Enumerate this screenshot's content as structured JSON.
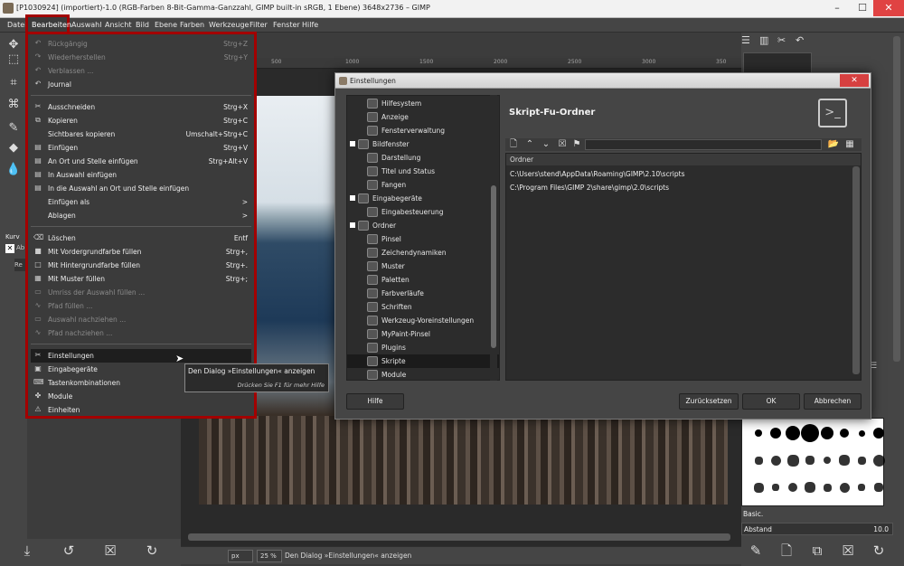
{
  "window": {
    "title": "[P1030924] (importiert)-1.0 (RGB-Farben 8-Bit-Gamma-Ganzzahl, GIMP built-in sRGB, 1 Ebene) 3648x2736 – GIMP",
    "minimize": "–",
    "maximize": "☐",
    "close": "✕"
  },
  "menubar": [
    "Datei",
    "Bearbeiten",
    "Auswahl",
    "Ansicht",
    "Bild",
    "Ebene",
    "Farben",
    "Werkzeuge",
    "Filter",
    "Fenster",
    "Hilfe"
  ],
  "edit_menu": {
    "items": [
      {
        "label": "Rückgängig",
        "shortcut": "Strg+Z",
        "disabled": true,
        "icon": "↶"
      },
      {
        "label": "Wiederherstellen",
        "shortcut": "Strg+Y",
        "disabled": true,
        "icon": "↷"
      },
      {
        "label": "Verblassen ...",
        "shortcut": "",
        "disabled": true,
        "icon": "↶"
      },
      {
        "label": "Journal",
        "shortcut": "",
        "disabled": false,
        "icon": "↶"
      },
      {
        "label": "Ausschneiden",
        "shortcut": "Strg+X",
        "disabled": false,
        "icon": "✂"
      },
      {
        "label": "Kopieren",
        "shortcut": "Strg+C",
        "disabled": false,
        "icon": "⧉"
      },
      {
        "label": "Sichtbares kopieren",
        "shortcut": "Umschalt+Strg+C",
        "disabled": false,
        "icon": ""
      },
      {
        "label": "Einfügen",
        "shortcut": "Strg+V",
        "disabled": false,
        "icon": "▤"
      },
      {
        "label": "An Ort und Stelle einfügen",
        "shortcut": "Strg+Alt+V",
        "disabled": false,
        "icon": "▤"
      },
      {
        "label": "In Auswahl einfügen",
        "shortcut": "",
        "disabled": false,
        "icon": "▤"
      },
      {
        "label": "In die Auswahl an Ort und Stelle einfügen",
        "shortcut": "",
        "disabled": false,
        "icon": "▤"
      },
      {
        "label": "Einfügen als",
        "shortcut": ">",
        "disabled": false,
        "icon": ""
      },
      {
        "label": "Ablagen",
        "shortcut": ">",
        "disabled": false,
        "icon": ""
      },
      {
        "label": "Löschen",
        "shortcut": "Entf",
        "disabled": false,
        "icon": "⌫"
      },
      {
        "label": "Mit Vordergrundfarbe füllen",
        "shortcut": "Strg+,",
        "disabled": false,
        "icon": "■"
      },
      {
        "label": "Mit Hintergrundfarbe füllen",
        "shortcut": "Strg+.",
        "disabled": false,
        "icon": "□"
      },
      {
        "label": "Mit Muster füllen",
        "shortcut": "Strg+;",
        "disabled": false,
        "icon": "▦"
      },
      {
        "label": "Umriss der Auswahl füllen ...",
        "shortcut": "",
        "disabled": true,
        "icon": "▭"
      },
      {
        "label": "Pfad füllen ...",
        "shortcut": "",
        "disabled": true,
        "icon": "∿"
      },
      {
        "label": "Auswahl nachziehen ...",
        "shortcut": "",
        "disabled": true,
        "icon": "▭"
      },
      {
        "label": "Pfad nachziehen ...",
        "shortcut": "",
        "disabled": true,
        "icon": "∿"
      },
      {
        "label": "Einstellungen",
        "shortcut": "",
        "disabled": false,
        "icon": "✂"
      },
      {
        "label": "Eingabegeräte",
        "shortcut": "",
        "disabled": false,
        "icon": "▣"
      },
      {
        "label": "Tastenkombinationen",
        "shortcut": "",
        "disabled": false,
        "icon": "⌨"
      },
      {
        "label": "Module",
        "shortcut": "",
        "disabled": false,
        "icon": "✤"
      },
      {
        "label": "Einheiten",
        "shortcut": "",
        "disabled": false,
        "icon": "⚠"
      }
    ]
  },
  "tooltip": {
    "line1": "Den Dialog »Einstellungen« anzeigen",
    "line2": "Drücken Sie F1 für mehr Hilfe"
  },
  "dialog": {
    "title": "Einstellungen",
    "tree": [
      {
        "label": "Hilfesystem",
        "indent": 1
      },
      {
        "label": "Anzeige",
        "indent": 1
      },
      {
        "label": "Fensterverwaltung",
        "indent": 1
      },
      {
        "label": "Bildfenster",
        "indent": 0
      },
      {
        "label": "Darstellung",
        "indent": 1
      },
      {
        "label": "Titel und Status",
        "indent": 1
      },
      {
        "label": "Fangen",
        "indent": 1
      },
      {
        "label": "Eingabegeräte",
        "indent": 0
      },
      {
        "label": "Eingabesteuerung",
        "indent": 1
      },
      {
        "label": "Ordner",
        "indent": 0
      },
      {
        "label": "Pinsel",
        "indent": 1
      },
      {
        "label": "Zeichendynamiken",
        "indent": 1
      },
      {
        "label": "Muster",
        "indent": 1
      },
      {
        "label": "Paletten",
        "indent": 1
      },
      {
        "label": "Farbverläufe",
        "indent": 1
      },
      {
        "label": "Schriften",
        "indent": 1
      },
      {
        "label": "Werkzeug-Voreinstellungen",
        "indent": 1
      },
      {
        "label": "MyPaint-Pinsel",
        "indent": 1
      },
      {
        "label": "Plugins",
        "indent": 1
      },
      {
        "label": "Skripte",
        "indent": 1
      },
      {
        "label": "Module",
        "indent": 1
      }
    ],
    "selected_index": 19,
    "section_title": "Skript-Fu-Ordner",
    "list_header": "Ordner",
    "folders": [
      "C:\\Users\\stend\\AppData\\Roaming\\GIMP\\2.10\\scripts",
      "C:\\Program Files\\GIMP 2\\share\\gimp\\2.0\\scripts"
    ],
    "buttons": {
      "help": "Hilfe",
      "reset": "Zurücksetzen",
      "ok": "OK",
      "cancel": "Abbrechen"
    }
  },
  "status": {
    "unit": "px",
    "zoom": "25 %",
    "message": "Den Dialog »Einstellungen« anzeigen"
  },
  "ruler": [
    "500",
    "1000",
    "1500",
    "2000",
    "2500",
    "3000",
    "350"
  ],
  "right_dock": {
    "brush_name": "Basic.",
    "spacing_label": "Abstand",
    "spacing_value": "10.0"
  },
  "left_panel": {
    "label": "Kurv",
    "ab": "Ab",
    "re": "Re"
  }
}
